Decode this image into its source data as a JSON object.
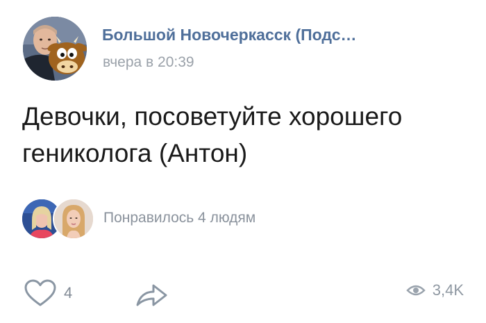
{
  "post": {
    "group_name": "Большой Новочеркасск (Подс…",
    "timestamp": "вчера в 20:39",
    "text": "Девочки, посоветуйте хорошего гениколога (Антон)"
  },
  "likes_summary": {
    "text": "Понравилось 4 людям"
  },
  "actions": {
    "like_icon": "heart-outline-icon",
    "like_count": "4",
    "share_icon": "share-arrow-icon",
    "views_icon": "eye-icon",
    "views_count": "3,4K"
  },
  "colors": {
    "group_name": "#4f6f9a",
    "secondary_text": "#8a929c",
    "icon": "#8a96a3",
    "body_text": "#1a1a1a"
  }
}
